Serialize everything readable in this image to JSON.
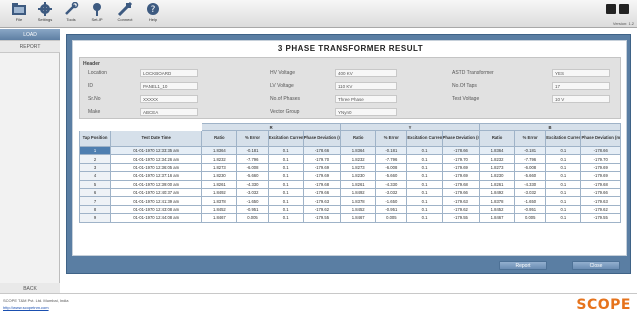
{
  "toolbar": {
    "items": [
      {
        "label": "File",
        "icon": "folder-icon"
      },
      {
        "label": "Settings",
        "icon": "gear-icon"
      },
      {
        "label": "Tools",
        "icon": "wrench-icon"
      },
      {
        "label": "Set-IP",
        "icon": "pin-icon"
      },
      {
        "label": "Connect",
        "icon": "plug-icon"
      },
      {
        "label": "Help",
        "icon": "help-icon"
      }
    ],
    "version": "Version: 1.2"
  },
  "nav": {
    "items": [
      "LOAD",
      "REPORT"
    ],
    "back": "BACK"
  },
  "page": {
    "title": "3 PHASE TRANSFORMER RESULT"
  },
  "header": {
    "section_title": "Header",
    "fields": {
      "location": {
        "label": "Location",
        "value": "LOCKBOARD"
      },
      "id": {
        "label": "ID",
        "value": "PANEL1_10"
      },
      "srno": {
        "label": "Sr.No",
        "value": "XXXXX"
      },
      "make": {
        "label": "Make",
        "value": "ABCEA"
      },
      "hv_voltage": {
        "label": "HV Voltage",
        "value": "400 KV"
      },
      "lv_voltage": {
        "label": "LV Voltage",
        "value": "110 KV"
      },
      "no_of_phases": {
        "label": "No.of Phases",
        "value": "Three Phase"
      },
      "vector_group": {
        "label": "Vector Group",
        "value": "YNyn0"
      },
      "astd_transformer": {
        "label": "ASTD Transformer",
        "value": "YES"
      },
      "no_of_taps": {
        "label": "No.Of Taps",
        "value": "17"
      },
      "test_voltage": {
        "label": "Test Voltage",
        "value": "10 V"
      }
    }
  },
  "table": {
    "phase_groups": [
      "R",
      "Y",
      "B"
    ],
    "col_tap": "Tap Position",
    "col_date": "Test Date Time",
    "phase_cols": [
      "Ratio",
      "% Error",
      "Excitation Current (mA)",
      "Phase Deviation (min)"
    ],
    "rows": [
      {
        "tap": "1",
        "date": "01-01-1970 12:33:35 am",
        "r": [
          "1.8364",
          "-0.181",
          "0.1",
          "-178.66"
        ],
        "y": [
          "1.8364",
          "-0.181",
          "0.1",
          "-178.66"
        ],
        "b": [
          "1.8364",
          "-0.181",
          "0.1",
          "-178.66"
        ]
      },
      {
        "tap": "2",
        "date": "01-01-1970 12:34:26 am",
        "r": [
          "1.8232",
          "-7.796",
          "0.1",
          "-179.70"
        ],
        "y": [
          "1.8232",
          "-7.796",
          "0.1",
          "-179.70"
        ],
        "b": [
          "1.8232",
          "-7.796",
          "0.1",
          "-179.70"
        ]
      },
      {
        "tap": "3",
        "date": "01-01-1970 12:36:05 am",
        "r": [
          "1.8273",
          "-6.008",
          "0.1",
          "-179.69"
        ],
        "y": [
          "1.8273",
          "-6.008",
          "0.1",
          "-179.69"
        ],
        "b": [
          "1.8273",
          "-6.008",
          "0.1",
          "-179.69"
        ]
      },
      {
        "tap": "4",
        "date": "01-01-1970 12:37:16 am",
        "r": [
          "1.8230",
          "-5.660",
          "0.1",
          "-179.69"
        ],
        "y": [
          "1.8230",
          "-5.660",
          "0.1",
          "-179.69"
        ],
        "b": [
          "1.8230",
          "-5.660",
          "0.1",
          "-179.69"
        ]
      },
      {
        "tap": "5",
        "date": "01-01-1970 12:39:00 am",
        "r": [
          "1.8261",
          "-4.330",
          "0.1",
          "-179.68"
        ],
        "y": [
          "1.8261",
          "-4.330",
          "0.1",
          "-179.68"
        ],
        "b": [
          "1.8261",
          "-4.330",
          "0.1",
          "-179.68"
        ]
      },
      {
        "tap": "6",
        "date": "01-01-1970 12:40:37 am",
        "r": [
          "1.8492",
          "-3.032",
          "0.1",
          "-179.66"
        ],
        "y": [
          "1.8492",
          "-3.032",
          "0.1",
          "-179.66"
        ],
        "b": [
          "1.8492",
          "-3.032",
          "0.1",
          "-179.66"
        ]
      },
      {
        "tap": "7",
        "date": "01-01-1970 12:41:39 am",
        "r": [
          "1.8378",
          "-1.650",
          "0.1",
          "-179.63"
        ],
        "y": [
          "1.8378",
          "-1.650",
          "0.1",
          "-179.63"
        ],
        "b": [
          "1.8378",
          "-1.650",
          "0.1",
          "-179.63"
        ]
      },
      {
        "tap": "8",
        "date": "01-01-1970 12:43:08 am",
        "r": [
          "1.8452",
          "-0.951",
          "0.1",
          "-179.62"
        ],
        "y": [
          "1.8452",
          "-0.951",
          "0.1",
          "-179.62"
        ],
        "b": [
          "1.8452",
          "-0.951",
          "0.1",
          "-179.62"
        ]
      },
      {
        "tap": "9",
        "date": "01-01-1970 12:44:08 am",
        "r": [
          "1.8467",
          "0.005",
          "0.1",
          "-179.55"
        ],
        "y": [
          "1.8467",
          "0.005",
          "0.1",
          "-179.55"
        ],
        "b": [
          "1.8467",
          "0.005",
          "0.1",
          "-179.55"
        ]
      }
    ]
  },
  "buttons": {
    "report": "Report",
    "close": "Close"
  },
  "footer": {
    "copyright": "SCOPE T&M Pvt. Ltd. Mumbai, India",
    "link": "http://www.scopetnm.com",
    "brand": "SCOPE"
  }
}
